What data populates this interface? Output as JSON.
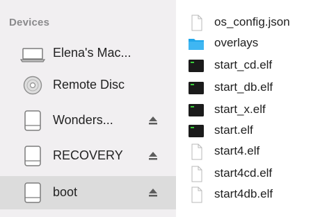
{
  "sidebar": {
    "header": "Devices",
    "items": [
      {
        "label": "Elena's Mac...",
        "icon": "laptop-icon",
        "eject": false,
        "selected": false
      },
      {
        "label": "Remote Disc",
        "icon": "disc-icon",
        "eject": false,
        "selected": false
      },
      {
        "label": "Wonders...",
        "icon": "drive-icon",
        "eject": true,
        "selected": false
      },
      {
        "label": "RECOVERY",
        "icon": "drive-icon",
        "eject": true,
        "selected": false
      },
      {
        "label": "boot",
        "icon": "drive-icon",
        "eject": true,
        "selected": true
      }
    ]
  },
  "files": [
    {
      "name": "os_config.json",
      "icon": "document-icon"
    },
    {
      "name": "overlays",
      "icon": "folder-icon"
    },
    {
      "name": "start_cd.elf",
      "icon": "executable-icon"
    },
    {
      "name": "start_db.elf",
      "icon": "executable-icon"
    },
    {
      "name": "start_x.elf",
      "icon": "executable-icon"
    },
    {
      "name": "start.elf",
      "icon": "executable-icon"
    },
    {
      "name": "start4.elf",
      "icon": "document-icon"
    },
    {
      "name": "start4cd.elf",
      "icon": "document-icon"
    },
    {
      "name": "start4db.elf",
      "icon": "document-icon"
    }
  ],
  "colors": {
    "sidebar_bg": "#f1eff1",
    "selected_bg": "#dcdcdc",
    "folder_blue": "#1fa6ea",
    "header_text": "#8a8a8c"
  }
}
